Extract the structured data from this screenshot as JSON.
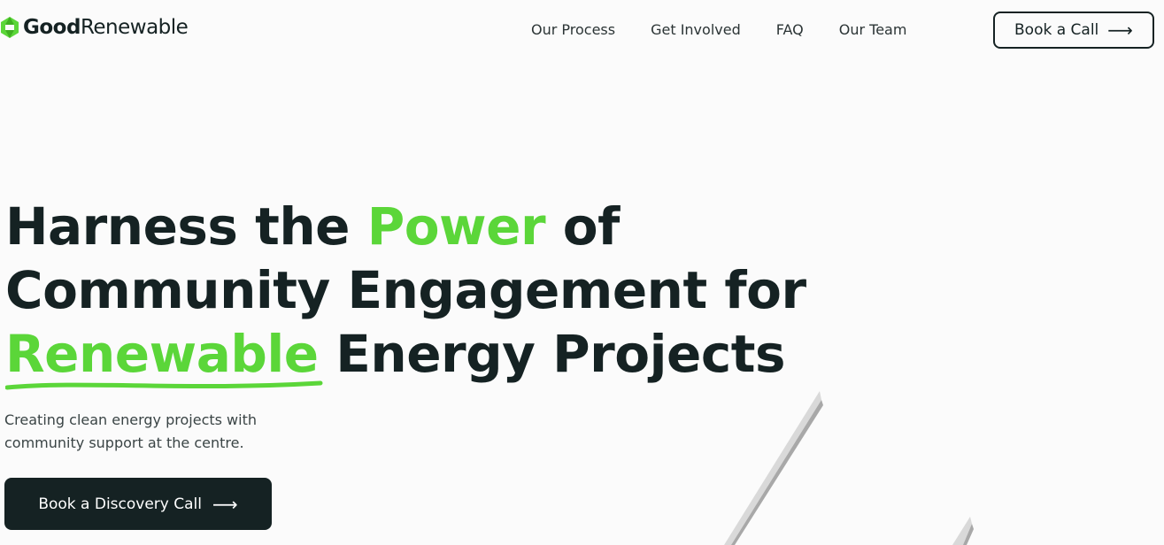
{
  "brand": {
    "name_bold": "Good",
    "name_rest": "Renewable",
    "accent_color": "#5bd639",
    "dark_color": "#152223"
  },
  "nav": {
    "items": [
      "Our Process",
      "Get Involved",
      "FAQ",
      "Our Team"
    ]
  },
  "header_cta": {
    "label": "Book a Call",
    "icon": "arrow-right-icon"
  },
  "hero": {
    "line1_a": "Harness the ",
    "line1_highlight": "Power",
    "line1_b": " of",
    "line2": "Community Engagement for",
    "line3_highlight": "Renewable",
    "line3_b": " Energy Projects",
    "subtitle": "Creating clean energy projects with community support at the centre.",
    "cta_label": "Book a Discovery Call",
    "cta_icon": "arrow-right-icon"
  }
}
